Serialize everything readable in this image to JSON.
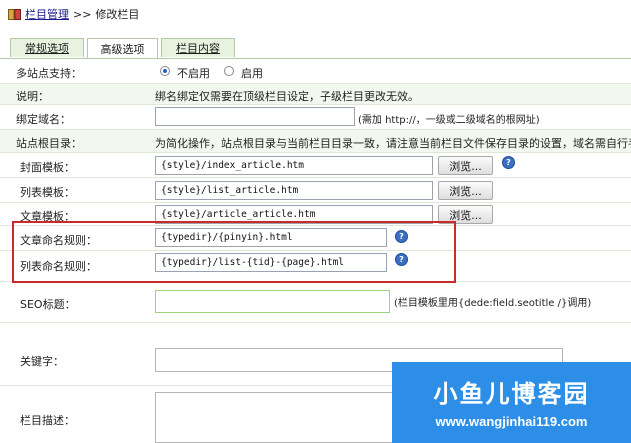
{
  "breadcrumb": {
    "section_link": "栏目管理",
    "separator": ">>",
    "current": "修改栏目"
  },
  "tabs": [
    {
      "label": "常规选项"
    },
    {
      "label": "高级选项",
      "active": true
    },
    {
      "label": "栏目内容"
    }
  ],
  "multisite": {
    "label": "多站点支持：",
    "options": [
      "不启用",
      "启用"
    ],
    "selected": "不启用"
  },
  "note": {
    "label": "说明：",
    "text": "绑名绑定仅需要在顶级栏目设定，子级栏目更改无效。"
  },
  "domain": {
    "label": "绑定域名：",
    "value": "",
    "hint": "(需加 http://，一级或二级域名的根网址)"
  },
  "site_root": {
    "label": "站点根目录：",
    "text": "为简化操作，站点根目录与当前栏目目录一致，请注意当前栏目文件保存目录的设置，域名需自行手"
  },
  "templates": {
    "browse_label": "浏览...",
    "cover": {
      "label": "封面模板：",
      "value": "{style}/index_article.htm"
    },
    "list": {
      "label": "列表模板：",
      "value": "{style}/list_article.htm"
    },
    "article": {
      "label": "文章模板：",
      "value": "{style}/article_article.htm"
    }
  },
  "naming": {
    "article": {
      "label": "文章命名规则：",
      "value": "{typedir}/{pinyin}.html"
    },
    "list": {
      "label": "列表命名规则：",
      "value": "{typedir}/list-{tid}-{page}.html"
    }
  },
  "seo": {
    "label": "SEO标题：",
    "value": "",
    "hint": "(栏目模板里用{dede:field.seotitle /}调用)"
  },
  "keywords": {
    "label": "关键字：",
    "value": ""
  },
  "description": {
    "label": "栏目描述：",
    "value": ""
  },
  "help_glyph": "?",
  "watermark": {
    "title": "小鱼儿博客园",
    "url": "www.wangjinhai119.com"
  },
  "colors": {
    "tab_bg": "#e8f3df",
    "highlight_box": "#c92a2a",
    "watermark_bg": "#2c8ee6",
    "help_icon": "#3b6fc2"
  }
}
